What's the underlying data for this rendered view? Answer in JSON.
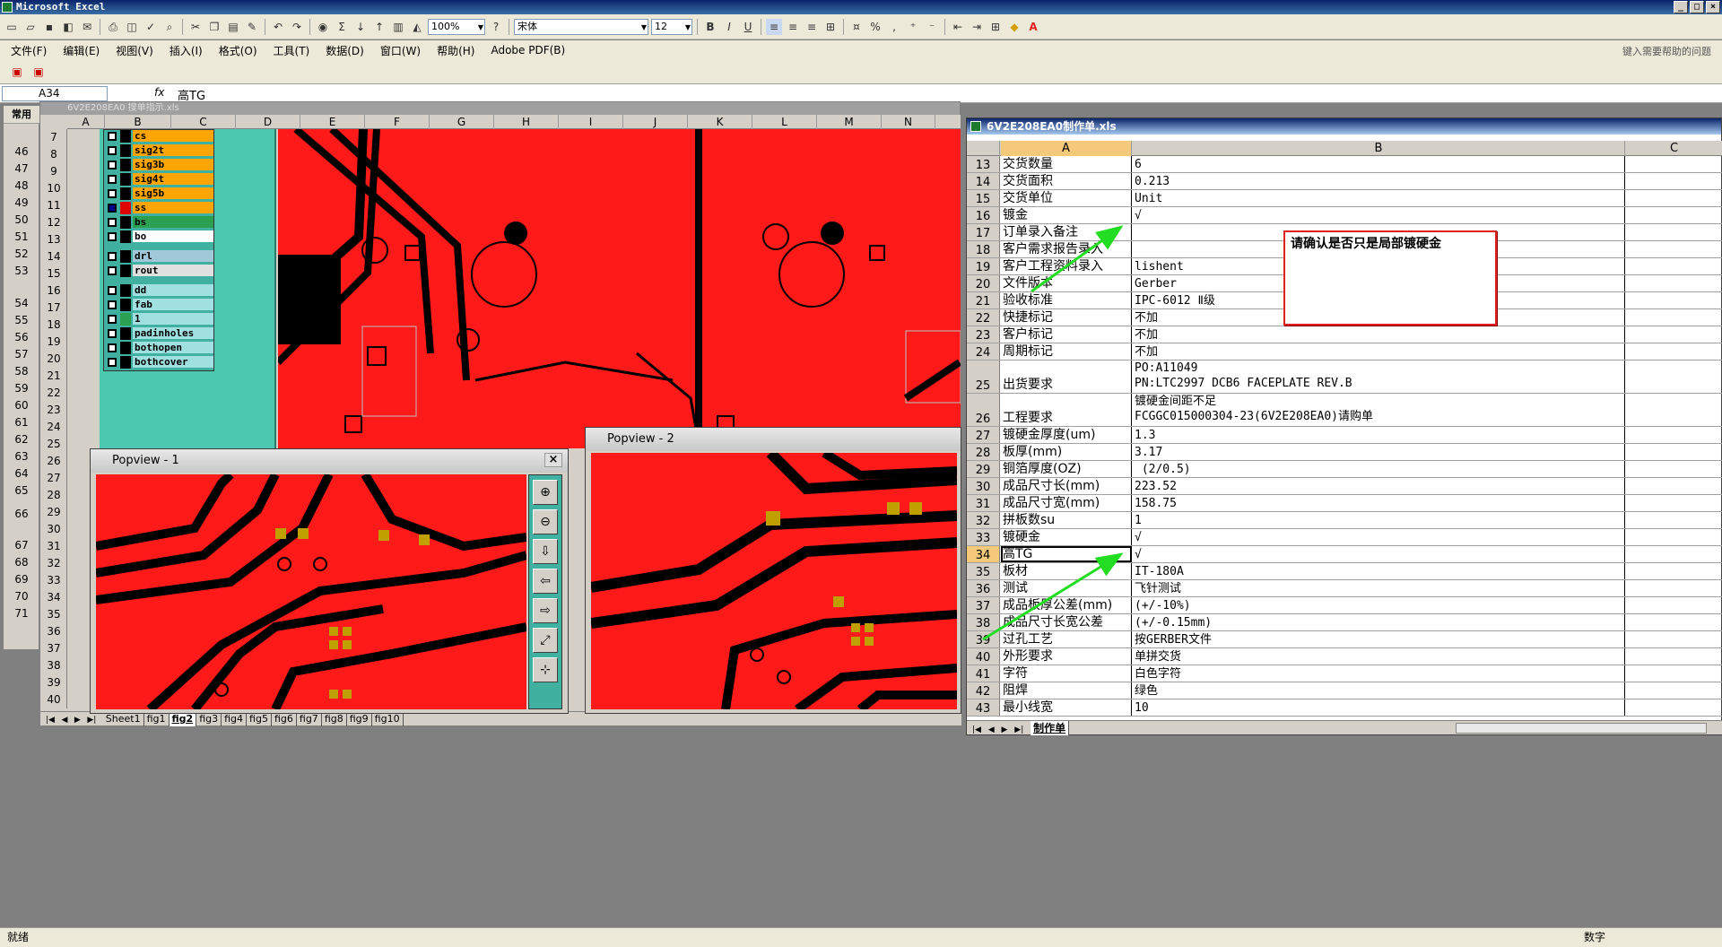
{
  "app": {
    "title": "Microsoft Excel",
    "window_buttons": [
      "_",
      "□",
      "×"
    ]
  },
  "toolbar": {
    "zoom": "100%",
    "font": "宋体",
    "font_size": "12",
    "bold": "B",
    "italic": "I",
    "underline": "U",
    "percent": "%",
    "sigma": "Σ"
  },
  "menu": {
    "items": [
      "文件(F)",
      "编辑(E)",
      "视图(V)",
      "插入(I)",
      "格式(O)",
      "工具(T)",
      "数据(D)",
      "窗口(W)",
      "帮助(H)",
      "Adobe PDF(B)"
    ],
    "help_placeholder": "键入需要帮助的问题"
  },
  "formula": {
    "name_box": "A34",
    "fx": "fx",
    "content": "高TG"
  },
  "left_strip": {
    "header": "常用",
    "rows": [
      "46",
      "47",
      "48",
      "49",
      "50",
      "51",
      "52",
      "53",
      "54",
      "55",
      "56",
      "57",
      "58",
      "59",
      "60",
      "61",
      "62",
      "63",
      "64",
      "65",
      "66",
      "67",
      "68",
      "69",
      "70",
      "71"
    ]
  },
  "gerber": {
    "title": "6V2E208EA0  搜单指示.xls",
    "columns": [
      "A",
      "B",
      "C",
      "D",
      "E",
      "F",
      "G",
      "H",
      "I",
      "J",
      "K",
      "L",
      "M",
      "N"
    ],
    "rows": [
      "7",
      "8",
      "9",
      "10",
      "11",
      "12",
      "13",
      "14",
      "15",
      "16",
      "17",
      "18",
      "19",
      "20",
      "21",
      "22",
      "23",
      "24",
      "25",
      "26",
      "27",
      "28",
      "29",
      "30",
      "31",
      "32",
      "33",
      "34",
      "35",
      "36",
      "37",
      "38",
      "39",
      "40"
    ],
    "layers": [
      {
        "name": "cs",
        "color": "#ffa500"
      },
      {
        "name": "sig2t",
        "color": "#ffa500"
      },
      {
        "name": "sig3b",
        "color": "#ffa500"
      },
      {
        "name": "sig4t",
        "color": "#ffa500"
      },
      {
        "name": "sig5b",
        "color": "#ffa500"
      },
      {
        "name": "ss",
        "color": "#ffa500"
      },
      {
        "name": "bs",
        "color": "#2aa050"
      },
      {
        "name": "bo",
        "color": "#ffffff"
      },
      {
        "name": "drl",
        "color": "#a0c8d8"
      },
      {
        "name": "rout",
        "color": "#e0e0e0"
      },
      {
        "name": "dd",
        "color": "#a0e0e0"
      },
      {
        "name": "fab",
        "color": "#a0e0e0"
      },
      {
        "name": "1",
        "color": "#a0e0e0"
      },
      {
        "name": "padinholes",
        "color": "#a0e0e0"
      },
      {
        "name": "bothopen",
        "color": "#a0e0e0"
      },
      {
        "name": "bothcover",
        "color": "#a0e0e0"
      }
    ],
    "sheet_tabs": [
      "Sheet1",
      "fig1",
      "fig2",
      "fig3",
      "fig4",
      "fig5",
      "fig6",
      "fig7",
      "fig8",
      "fig9",
      "fig10"
    ],
    "active_tab": "fig2"
  },
  "popview1": {
    "title": "Popview - 1",
    "close": "×"
  },
  "popview2": {
    "title": "Popview - 2"
  },
  "sheet": {
    "title": "6V2E208EA0制作单.xls",
    "columns": [
      "A",
      "B",
      "C"
    ],
    "rows": [
      {
        "n": "13",
        "a": "交货数量",
        "b": "6"
      },
      {
        "n": "14",
        "a": "交货面积",
        "b": "0.213"
      },
      {
        "n": "15",
        "a": "交货单位",
        "b": "Unit"
      },
      {
        "n": "16",
        "a": "镀金",
        "b": "√"
      },
      {
        "n": "17",
        "a": "订单录入备注",
        "b": ""
      },
      {
        "n": "18",
        "a": "客户需求报告录入",
        "b": ""
      },
      {
        "n": "19",
        "a": "客户工程资料录入",
        "b": "lishent"
      },
      {
        "n": "20",
        "a": "文件版本",
        "b": "Gerber"
      },
      {
        "n": "21",
        "a": "验收标准",
        "b": "IPC-6012 Ⅱ级"
      },
      {
        "n": "22",
        "a": "快捷标记",
        "b": "不加"
      },
      {
        "n": "23",
        "a": "客户标记",
        "b": "不加"
      },
      {
        "n": "24",
        "a": "周期标记",
        "b": "不加"
      },
      {
        "n": "25",
        "a": "出货要求",
        "b": "PO:A11049\nPN:LTC2997 DCB6 FACEPLATE REV.B"
      },
      {
        "n": "26",
        "a": "工程要求",
        "b": "镀硬金间距不足\nFCGGC015000304-23(6V2E208EA0)请购单"
      },
      {
        "n": "27",
        "a": "镀硬金厚度(um)",
        "b": "1.3"
      },
      {
        "n": "28",
        "a": "板厚(mm)",
        "b": "3.17"
      },
      {
        "n": "29",
        "a": "铜箔厚度(OZ)",
        "b": " (2/0.5)"
      },
      {
        "n": "30",
        "a": "成品尺寸长(mm)",
        "b": "223.52"
      },
      {
        "n": "31",
        "a": "成品尺寸宽(mm)",
        "b": "158.75"
      },
      {
        "n": "32",
        "a": "拼板数su",
        "b": "1"
      },
      {
        "n": "33",
        "a": "镀硬金",
        "b": "√"
      },
      {
        "n": "34",
        "a": "高TG",
        "b": "√"
      },
      {
        "n": "35",
        "a": "板材",
        "b": "IT-180A"
      },
      {
        "n": "36",
        "a": "测试",
        "b": "飞针测试"
      },
      {
        "n": "37",
        "a": "成品板厚公差(mm)",
        "b": "(+/-10%)"
      },
      {
        "n": "38",
        "a": "成品尺寸长宽公差",
        "b": "(+/-0.15mm)"
      },
      {
        "n": "39",
        "a": "过孔工艺",
        "b": "按GERBER文件"
      },
      {
        "n": "40",
        "a": "外形要求",
        "b": "单拼交货"
      },
      {
        "n": "41",
        "a": "字符",
        "b": "白色字符"
      },
      {
        "n": "42",
        "a": "阻焊",
        "b": "绿色"
      },
      {
        "n": "43",
        "a": "最小线宽",
        "b": "10"
      }
    ],
    "tab": "制作单"
  },
  "comment": {
    "text": "请确认是否只是局部镀硬金"
  },
  "status": {
    "left": "就绪",
    "right": "数字"
  },
  "colors": {
    "pcb_red": "#ff1a1a",
    "arrow": "#22dd22",
    "comment_border": "#e02020"
  }
}
